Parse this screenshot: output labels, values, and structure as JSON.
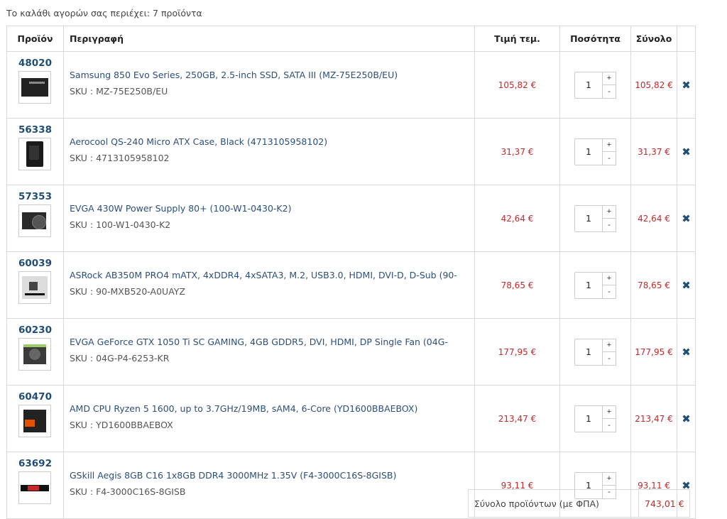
{
  "cart_summary": "Το καλάθι αγορών σας περιέχει: 7 προϊόντα",
  "headers": {
    "product": "Προϊόν",
    "description": "Περιγραφή",
    "unit_price": "Τιμή τεμ.",
    "quantity": "Ποσότητα",
    "total": "Σύνολο"
  },
  "qty_plus": "+",
  "qty_minus": "-",
  "remove_glyph": "✖",
  "sku_prefix": "SKU : ",
  "items": [
    {
      "id": "48020",
      "title": "Samsung 850 Evo Series, 250GB, 2.5-inch SSD, SATA III (MZ-75E250B/EU)",
      "sku": "SKU : MZ-75E250B/EU",
      "unit_price": "105,82 €",
      "qty": "1",
      "total": "105,82 €",
      "thumb": "ssd"
    },
    {
      "id": "56338",
      "title": "Aerocool QS-240 Micro ATX Case, Black (4713105958102)",
      "sku": "SKU : 4713105958102",
      "unit_price": "31,37 €",
      "qty": "1",
      "total": "31,37 €",
      "thumb": "case"
    },
    {
      "id": "57353",
      "title": "EVGA 430W Power Supply 80+ (100-W1-0430-K2)",
      "sku": "SKU : 100-W1-0430-K2",
      "unit_price": "42,64 €",
      "qty": "1",
      "total": "42,64 €",
      "thumb": "psu"
    },
    {
      "id": "60039",
      "title": "ASRock AB350M PRO4 mATX, 4xDDR4, 4xSATA3, M.2, USB3.0, HDMI, DVI-D, D-Sub (90-",
      "sku": "SKU : 90-MXB520-A0UAYZ",
      "unit_price": "78,65 €",
      "qty": "1",
      "total": "78,65 €",
      "thumb": "mb"
    },
    {
      "id": "60230",
      "title": "EVGA GeForce GTX 1050 Ti SC GAMING, 4GB GDDR5, DVI, HDMI, DP Single Fan (04G-",
      "sku": "SKU : 04G-P4-6253-KR",
      "unit_price": "177,95 €",
      "qty": "1",
      "total": "177,95 €",
      "thumb": "gpu"
    },
    {
      "id": "60470",
      "title": "AMD CPU Ryzen 5 1600, up to 3.7GHz/19MB, sAM4, 6-Core (YD1600BBAEBOX)",
      "sku": "SKU : YD1600BBAEBOX",
      "unit_price": "213,47 €",
      "qty": "1",
      "total": "213,47 €",
      "thumb": "cpu"
    },
    {
      "id": "63692",
      "title": "GSkill Aegis 8GB C16 1x8GB DDR4 3000MHz 1.35V (F4-3000C16S-8GISB)",
      "sku": "SKU : F4-3000C16S-8GISB",
      "unit_price": "93,11 €",
      "qty": "1",
      "total": "93,11 €",
      "thumb": "ram"
    }
  ],
  "totals": {
    "products_label": "Σύνολο προϊόντων (με ΦΠΑ)",
    "products_value": "743,01 €"
  }
}
